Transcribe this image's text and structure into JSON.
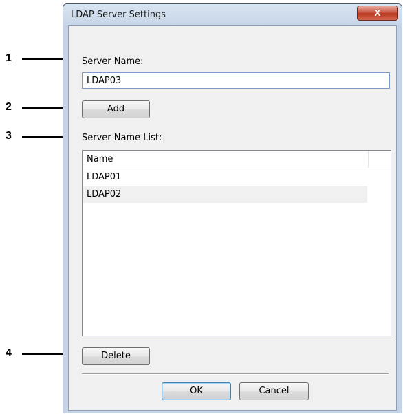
{
  "callouts": [
    "1",
    "2",
    "3",
    "4"
  ],
  "dialog": {
    "title": "LDAP Server Settings",
    "close_glyph": "X",
    "server_name_label": "Server Name:",
    "server_name_value": "LDAP03",
    "add_label": "Add",
    "server_list_label": "Server Name List:",
    "list": {
      "column_header": "Name",
      "rows": [
        "LDAP01",
        "LDAP02"
      ],
      "selected_index": 1
    },
    "delete_label": "Delete",
    "ok_label": "OK",
    "cancel_label": "Cancel"
  },
  "colors": {
    "titlebar": "#c6d5e8",
    "close_button": "#c75440",
    "client_bg": "#f0f0f0",
    "default_button_border": "#3c7fb1"
  },
  "icons": {
    "close": "close-icon"
  }
}
